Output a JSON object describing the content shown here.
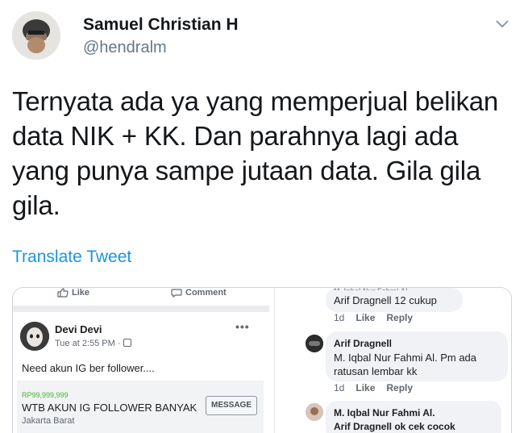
{
  "tweet": {
    "display_name": "Samuel Christian H",
    "handle": "@hendralm",
    "text": "Ternyata ada ya yang memperjual belikan data NIK + KK. Dan parahnya lagi ada yang punya sampe jutaan data. Gila gila gila.",
    "translate_label": "Translate Tweet"
  },
  "fb_post": {
    "like_label": "Like",
    "comment_label": "Comment",
    "author": "Devi Devi",
    "time": "Tue at 2:55 PM ·",
    "more_label": "•••",
    "body": "Need akun IG ber follower....",
    "listing": {
      "price": "RP99,999,999",
      "title": "WTB AKUN IG FOLLOWER BANYAK",
      "location": "Jakarta Barat",
      "message_label": "MESSAGE"
    }
  },
  "fb_comments": {
    "clipped_name": "M. Iqbal Nur Fahmi Al.",
    "c1": {
      "text": "Arif Dragnell 12 cukup",
      "age": "1d",
      "like": "Like",
      "reply": "Reply"
    },
    "c2": {
      "author": "Arif Dragnell",
      "text": "M. Iqbal Nur Fahmi Al. Pm ada ratusan lembar kk",
      "age": "1d",
      "like": "Like",
      "reply": "Reply"
    },
    "c3": {
      "author": "M. Iqbal Nur Fahmi Al.",
      "text": "Arif Dragnell ok cek cocok"
    }
  },
  "colors": {
    "link": "#1b95e0",
    "muted": "#657786",
    "fb_green": "#42b72a"
  },
  "icons": {
    "menu": "chevron-down-icon",
    "like": "thumbs-up-icon",
    "comment": "speech-bubble-icon",
    "privacy": "globe-icon"
  }
}
